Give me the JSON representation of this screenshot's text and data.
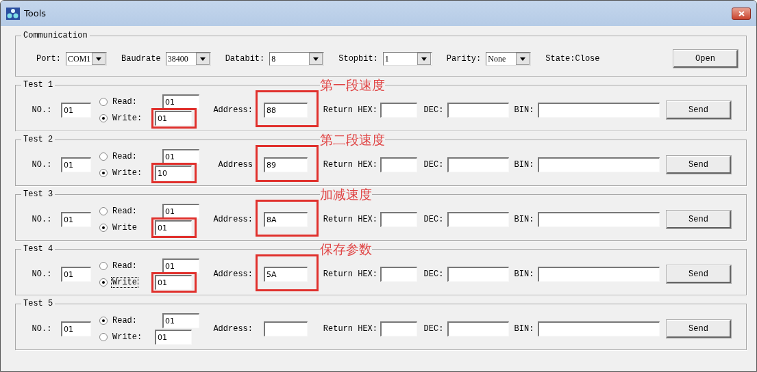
{
  "window": {
    "title": "Tools"
  },
  "communication": {
    "legend": "Communication",
    "settings": [
      {
        "label": "Port:",
        "value": "COM1"
      },
      {
        "label": "Baudrate",
        "value": "38400"
      },
      {
        "label": "Databit:",
        "value": "8"
      },
      {
        "label": "Stopbit:",
        "value": "1"
      },
      {
        "label": "Parity:",
        "value": "None"
      }
    ],
    "state": "State:Close",
    "button": "Open"
  },
  "tests": [
    {
      "legend": "Test 1",
      "no_label": "NO.:",
      "no": "01",
      "modes": [
        {
          "label": "Read:",
          "value": "01",
          "selected": false,
          "focused": false
        },
        {
          "label": "Write:",
          "value": "01",
          "selected": true,
          "focused": false
        }
      ],
      "address_label": "Address:",
      "address": "88",
      "return_hex_label": "Return HEX:",
      "dec_label": "DEC:",
      "bin_label": "BIN:",
      "button": "Send",
      "annotation": "第一段速度",
      "highlighted": true
    },
    {
      "legend": "Test 2",
      "no_label": "NO.:",
      "no": "01",
      "modes": [
        {
          "label": "Read:",
          "value": "01",
          "selected": false,
          "focused": false
        },
        {
          "label": "Write:",
          "value": "10",
          "selected": true,
          "focused": false
        }
      ],
      "address_label": "Address",
      "address": "89",
      "return_hex_label": "Return HEX:",
      "dec_label": "DEC:",
      "bin_label": "BIN:",
      "button": "Send",
      "annotation": "第二段速度",
      "highlighted": true
    },
    {
      "legend": "Test 3",
      "no_label": "NO.:",
      "no": "01",
      "modes": [
        {
          "label": "Read:",
          "value": "01",
          "selected": false,
          "focused": false
        },
        {
          "label": "Write",
          "value": "01",
          "selected": true,
          "focused": false
        }
      ],
      "address_label": "Address:",
      "address": "8A",
      "return_hex_label": "Return HEX:",
      "dec_label": "DEC:",
      "bin_label": "BIN:",
      "button": "Send",
      "annotation": "加减速度",
      "highlighted": true
    },
    {
      "legend": "Test 4",
      "no_label": "NO.:",
      "no": "01",
      "modes": [
        {
          "label": "Read:",
          "value": "01",
          "selected": false,
          "focused": false
        },
        {
          "label": "Write",
          "value": "01",
          "selected": true,
          "focused": true
        }
      ],
      "address_label": "Address:",
      "address": "5A",
      "return_hex_label": "Return HEX:",
      "dec_label": "DEC:",
      "bin_label": "BIN:",
      "button": "Send",
      "annotation": "保存参数",
      "highlighted": true
    },
    {
      "legend": "Test 5",
      "no_label": "NO.:",
      "no": "01",
      "modes": [
        {
          "label": "Read:",
          "value": "01",
          "selected": true,
          "focused": false
        },
        {
          "label": "Write:",
          "value": "01",
          "selected": false,
          "focused": false
        }
      ],
      "address_label": "Address:",
      "return_hex_label": "Return HEX:",
      "dec_label": "DEC:",
      "bin_label": "BIN:",
      "button": "Send",
      "highlighted": false
    }
  ]
}
